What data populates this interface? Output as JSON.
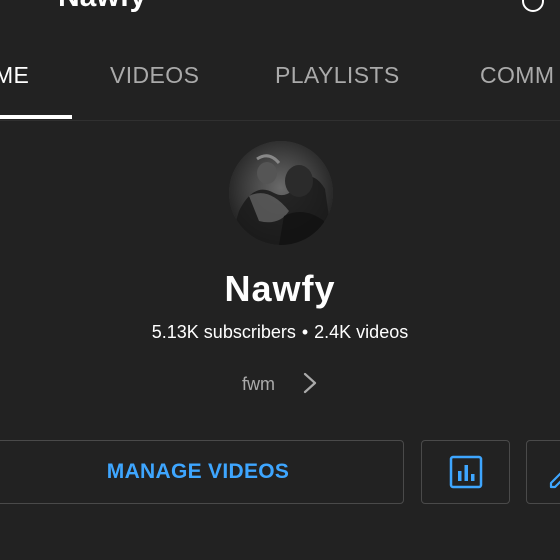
{
  "header": {
    "partial_title": "Nawfy"
  },
  "tabs": [
    {
      "label": "HOME",
      "visible_label": "ME",
      "active": true
    },
    {
      "label": "VIDEOS",
      "active": false
    },
    {
      "label": "PLAYLISTS",
      "active": false
    },
    {
      "label": "COMMUNITY",
      "visible_label": "COMM",
      "active": false
    }
  ],
  "channel": {
    "name": "Nawfy",
    "subscribers": "5.13K subscribers",
    "separator": "•",
    "videos": "2.4K videos",
    "link_text": "fwm",
    "avatar_icon": "channel-avatar-photo"
  },
  "actions": {
    "manage_videos_label": "MANAGE VIDEOS",
    "analytics_icon": "analytics-bar-chart-icon",
    "edit_icon": "edit-pencil-icon"
  },
  "colors": {
    "background": "#222222",
    "accent_blue": "#3ea6ff",
    "text_primary": "#ffffff",
    "text_secondary": "#aaaaaa",
    "border": "#4a4a4a"
  }
}
